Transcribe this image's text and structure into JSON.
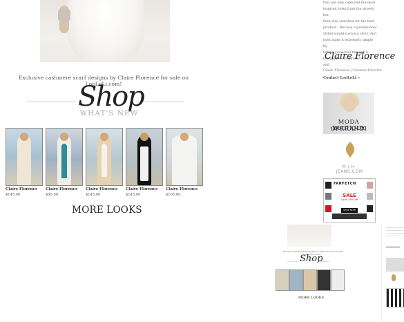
{
  "hero": {
    "alt": ""
  },
  "tagline": "Exclusive cashmere scarf designs by Claire Florence for sale on LooLoLi.com!",
  "shop_logo": {
    "word": "Shop",
    "sub": "WHAT'S NEW"
  },
  "products": [
    {
      "name": "Claire Florence",
      "price": "$145.00",
      "coat": "#efe6d6",
      "scarf": "#ffffff"
    },
    {
      "name": "Claire Florence",
      "price": "$95.00",
      "coat": "#f0ede6",
      "scarf": "#2f8b94"
    },
    {
      "name": "Claire Florence",
      "price": "$145.00",
      "coat": "#e7d2b0",
      "scarf": "#f4f2ec"
    },
    {
      "name": "Claire Florence",
      "price": "$145.00",
      "coat": "#111111",
      "scarf": "#f1f1f1"
    },
    {
      "name": "Claire Florence",
      "price": "$165.00",
      "coat": "#f3f3f1",
      "scarf": "#ffffff"
    }
  ],
  "more_looks": "MORE LOOKS",
  "sidebar": {
    "intro_lines": [
      "that are only captured the most",
      "inspired looks from the streets, but",
      "then also searched for the best",
      "product – the way a professional",
      "stylist would source a story. And",
      "then make it extremely simple by,",
      "letting you scroll through a",
      "(shoppable) inspiration board and",
      "check out – right on your phone!"
    ],
    "signature": "Claire Florence",
    "caption": "Claire Florence | Creative Director",
    "contact": "Contact LooLoLi »",
    "ad_moda": {
      "line1": "MODA OPERANDI",
      "line2": "BOUTIQUE"
    },
    "ad_mih": {
      "text": "M.i.H-JEANS.COM"
    },
    "ad_farfetch": {
      "brand": "FARFETCH",
      "sale": "SALE",
      "sub": "Up to 40% off",
      "button": "SHOP NOW"
    }
  },
  "mini_preview": {
    "word": "Shop",
    "more": "MORE LOOKS"
  },
  "colors": {
    "accent": "#222222",
    "sale": "#dd2222",
    "rule": "#cfcfcf",
    "mih_gold": "#c9a25a"
  }
}
